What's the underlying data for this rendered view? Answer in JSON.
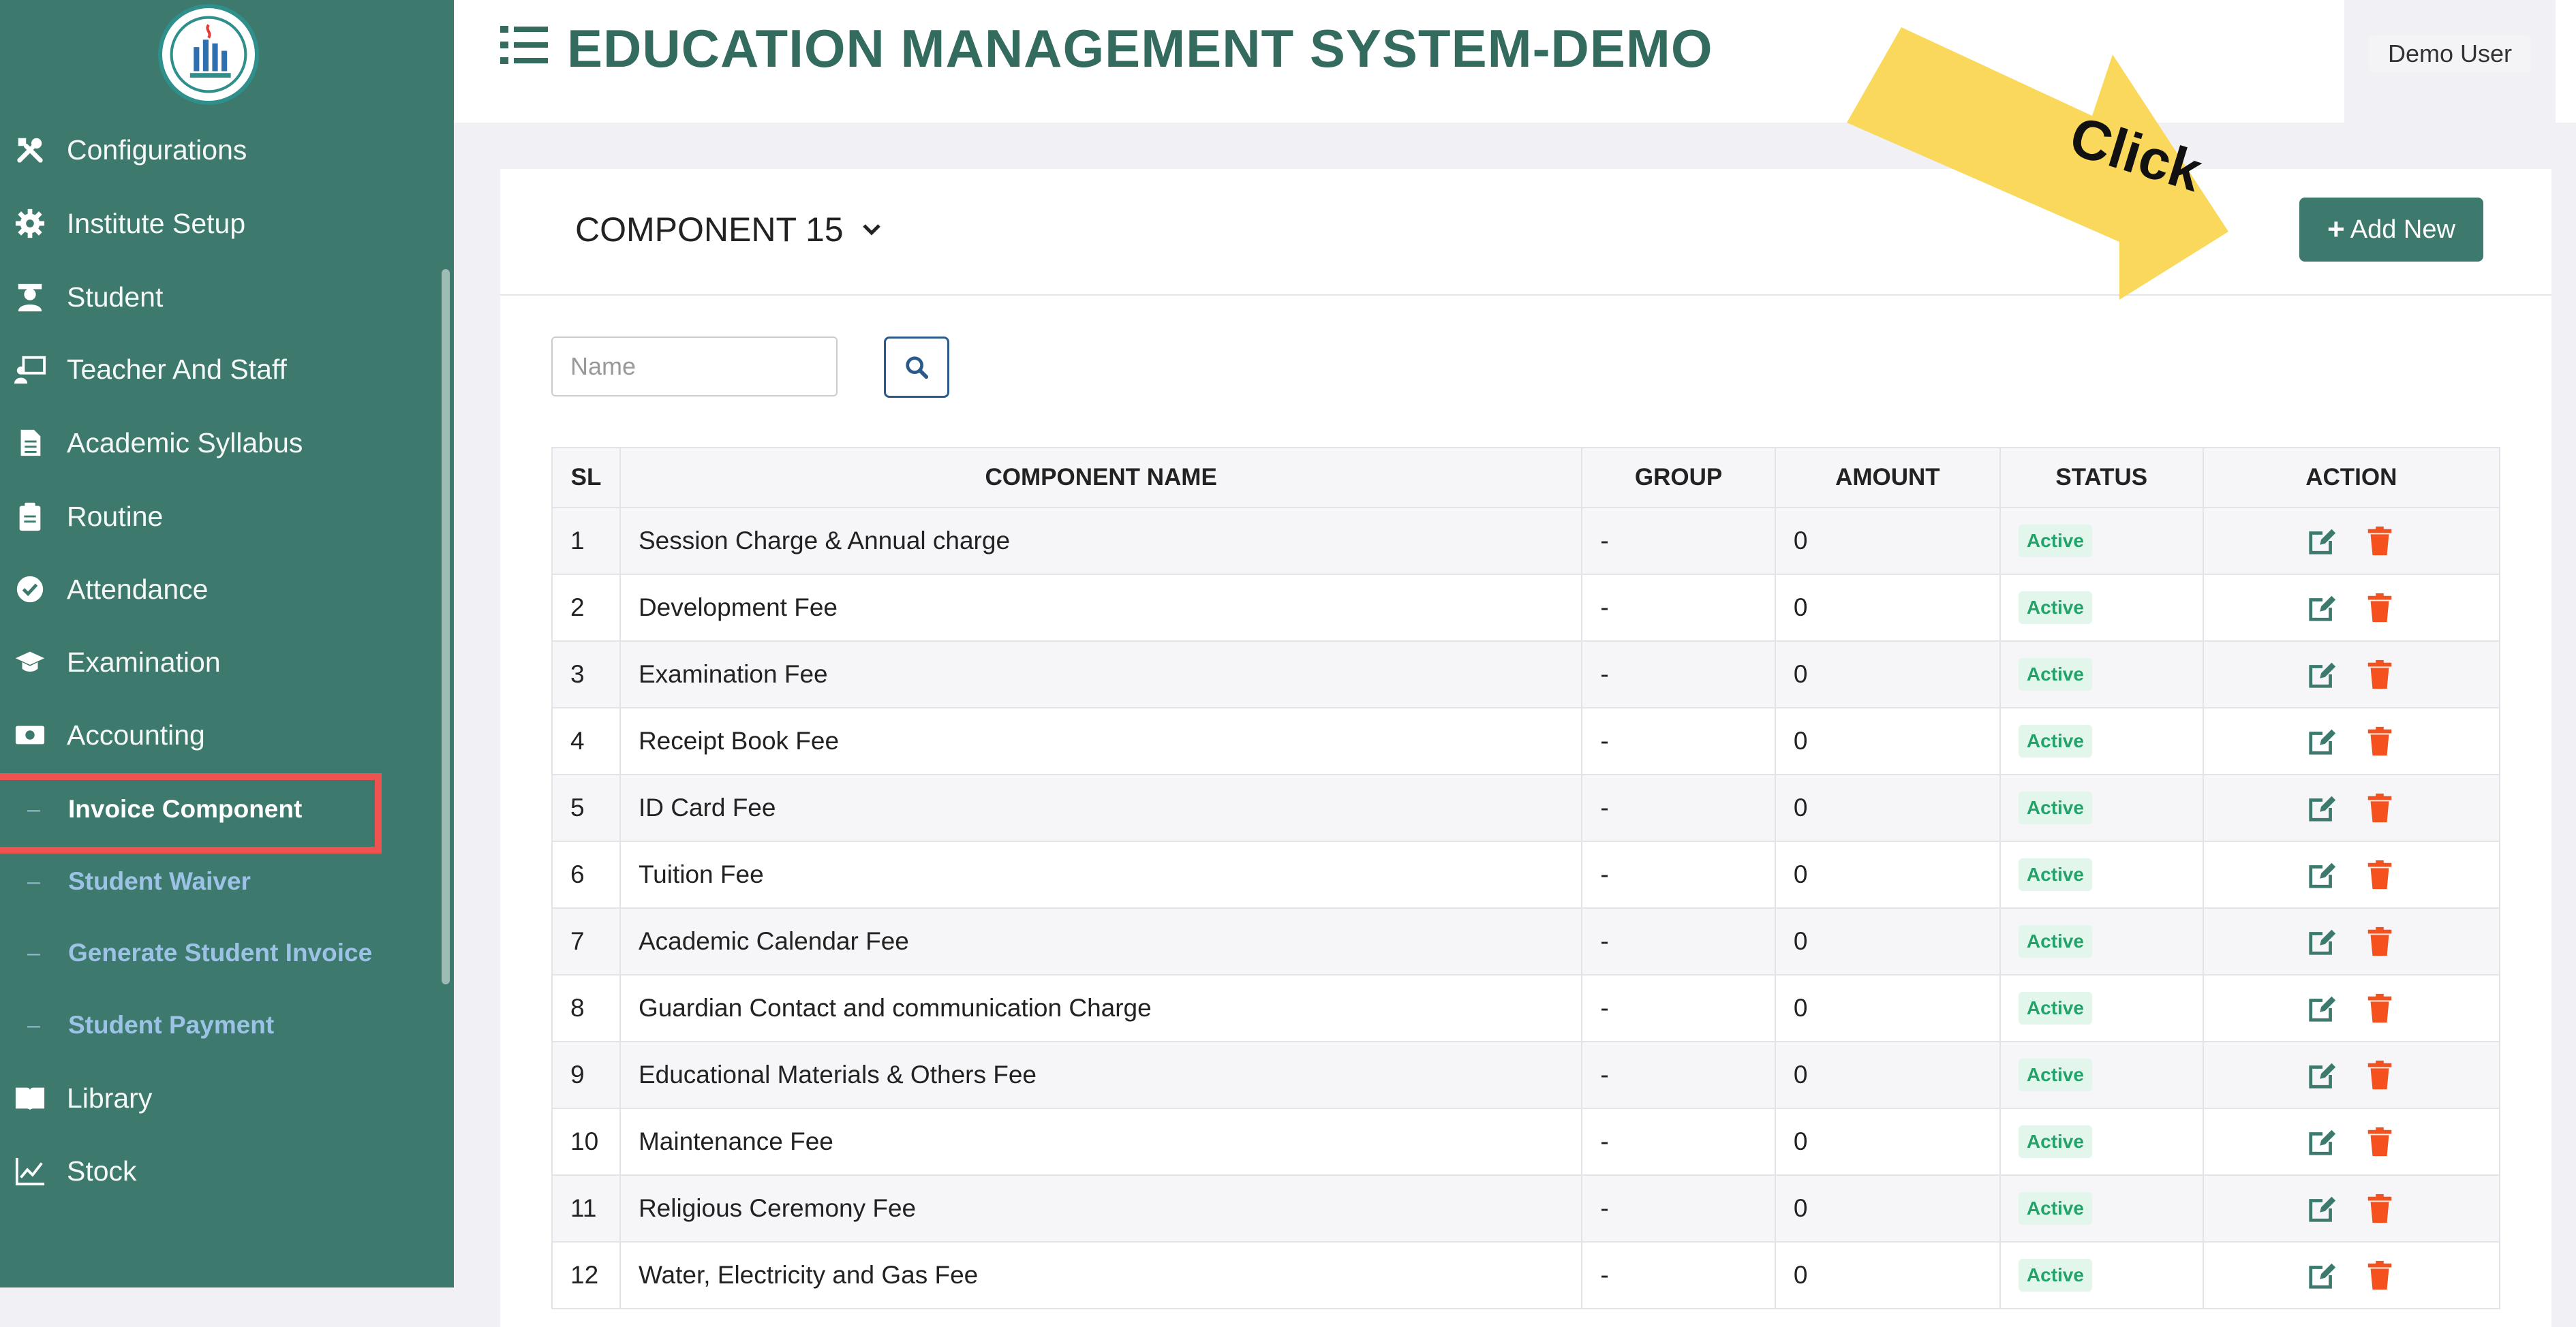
{
  "app": {
    "title": "EDUCATION MANAGEMENT SYSTEM-DEMO",
    "user": "Demo User"
  },
  "sidebar": {
    "items": [
      {
        "label": "Configurations",
        "icon": "tools-icon"
      },
      {
        "label": "Institute Setup",
        "icon": "gear-icon"
      },
      {
        "label": "Student",
        "icon": "student-icon"
      },
      {
        "label": "Teacher And Staff",
        "icon": "teacher-icon"
      },
      {
        "label": "Academic Syllabus",
        "icon": "document-icon"
      },
      {
        "label": "Routine",
        "icon": "clipboard-icon"
      },
      {
        "label": "Attendance",
        "icon": "check-circle-icon"
      },
      {
        "label": "Examination",
        "icon": "graduation-cap-icon"
      },
      {
        "label": "Accounting",
        "icon": "money-icon"
      },
      {
        "label": "Library",
        "icon": "book-icon"
      },
      {
        "label": "Stock",
        "icon": "chart-line-icon"
      }
    ],
    "subitems": [
      {
        "label": "Invoice Component",
        "active": true
      },
      {
        "label": "Student Waiver",
        "active": false
      },
      {
        "label": "Generate Student Invoice",
        "active": false
      },
      {
        "label": "Student Payment",
        "active": false
      }
    ]
  },
  "card": {
    "component_select": "COMPONENT 15",
    "add_button": "Add New",
    "search_placeholder": "Name"
  },
  "annotation": {
    "text": "Click",
    "arrow_color": "#f9d85c",
    "highlight_color": "#ef5350"
  },
  "table": {
    "headers": [
      "SL",
      "COMPONENT NAME",
      "GROUP",
      "AMOUNT",
      "STATUS",
      "ACTION"
    ],
    "rows": [
      {
        "sl": "1",
        "name": "Session Charge & Annual charge",
        "group": "-",
        "amount": "0",
        "status": "Active"
      },
      {
        "sl": "2",
        "name": "Development Fee",
        "group": "-",
        "amount": "0",
        "status": "Active"
      },
      {
        "sl": "3",
        "name": "Examination Fee",
        "group": "-",
        "amount": "0",
        "status": "Active"
      },
      {
        "sl": "4",
        "name": "Receipt Book Fee",
        "group": "-",
        "amount": "0",
        "status": "Active"
      },
      {
        "sl": "5",
        "name": "ID Card Fee",
        "group": "-",
        "amount": "0",
        "status": "Active"
      },
      {
        "sl": "6",
        "name": "Tuition Fee",
        "group": "-",
        "amount": "0",
        "status": "Active"
      },
      {
        "sl": "7",
        "name": "Academic Calendar Fee",
        "group": "-",
        "amount": "0",
        "status": "Active"
      },
      {
        "sl": "8",
        "name": "Guardian Contact and communication Charge",
        "group": "-",
        "amount": "0",
        "status": "Active"
      },
      {
        "sl": "9",
        "name": "Educational Materials & Others Fee",
        "group": "-",
        "amount": "0",
        "status": "Active"
      },
      {
        "sl": "10",
        "name": "Maintenance Fee",
        "group": "-",
        "amount": "0",
        "status": "Active"
      },
      {
        "sl": "11",
        "name": "Religious Ceremony Fee",
        "group": "-",
        "amount": "0",
        "status": "Active"
      },
      {
        "sl": "12",
        "name": "Water, Electricity and Gas Fee",
        "group": "-",
        "amount": "0",
        "status": "Active"
      }
    ]
  },
  "colors": {
    "brand": "#3d7a6d",
    "title": "#336b5f",
    "active_badge": "#22a36a",
    "edit": "#3d7a6d",
    "delete": "#f4511e"
  }
}
